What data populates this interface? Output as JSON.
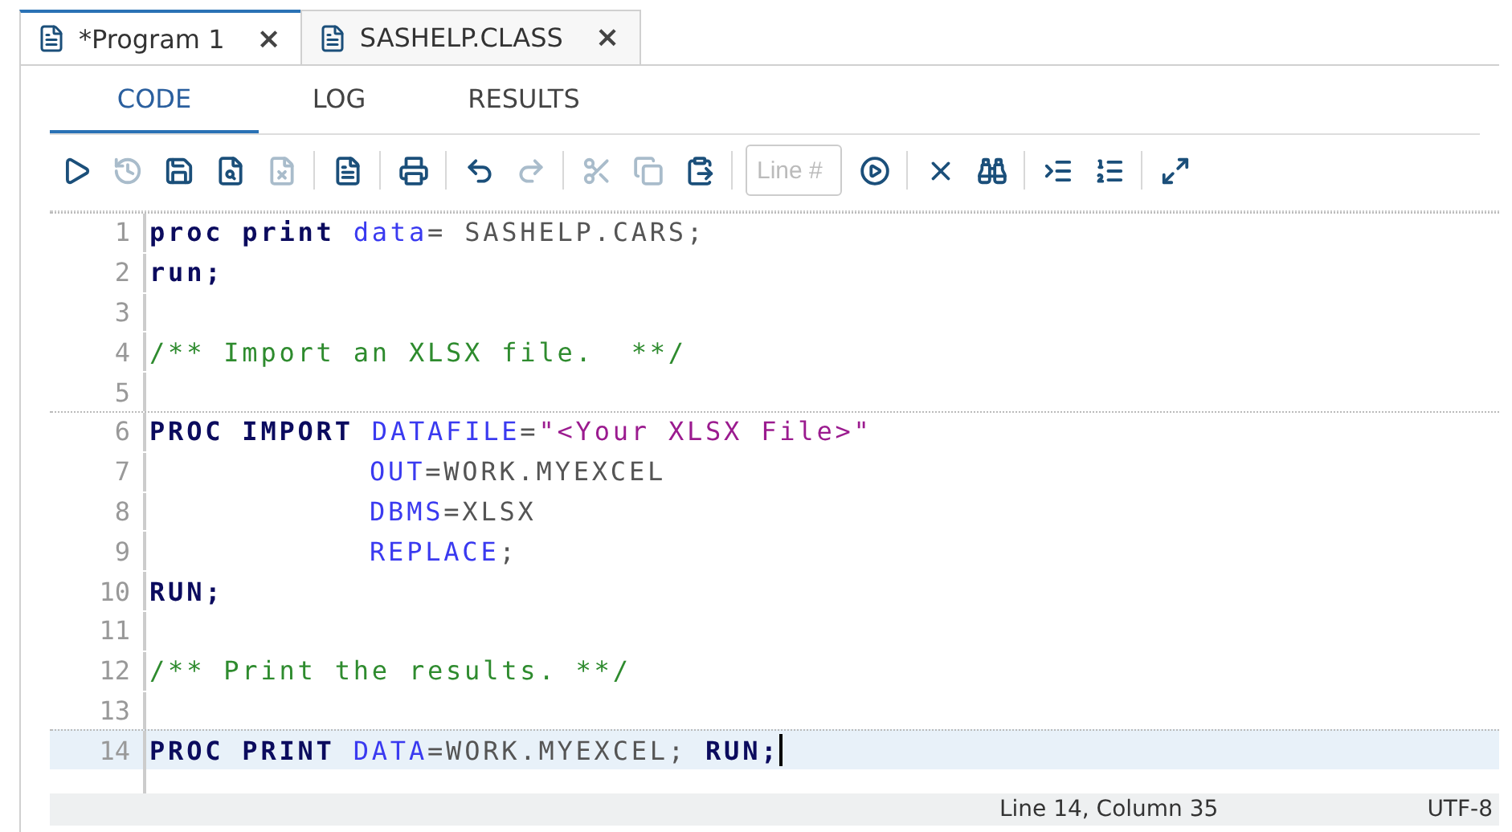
{
  "tabs": [
    {
      "label": "*Program 1",
      "selected": true,
      "close": "×"
    },
    {
      "label": "SASHELP.CLASS",
      "selected": false,
      "close": "×"
    }
  ],
  "subtabs": [
    {
      "label": "CODE",
      "selected": true
    },
    {
      "label": "LOG",
      "selected": false
    },
    {
      "label": "RESULTS",
      "selected": false
    }
  ],
  "toolbar": {
    "buttons": [
      {
        "disabled": false
      },
      {
        "disabled": true
      },
      {
        "disabled": false
      },
      {
        "disabled": false
      },
      {
        "disabled": true
      },
      {
        "disabled": false
      },
      {
        "disabled": false
      },
      {
        "disabled": false
      },
      {
        "disabled": true
      },
      {
        "disabled": true
      },
      {
        "disabled": true
      },
      {
        "disabled": false
      },
      {
        "disabled": false
      },
      {
        "disabled": false
      },
      {
        "disabled": false
      },
      {
        "disabled": false
      },
      {
        "disabled": false
      },
      {
        "disabled": false
      }
    ],
    "line_field": {
      "placeholder": "Line #"
    }
  },
  "editor": {
    "lines": [
      {
        "number": "1",
        "step_start": true,
        "current": false,
        "continuation": false,
        "tokens": [
          {
            "kind": "keyword",
            "text": "proc print"
          },
          {
            "kind": "option",
            "text": " data"
          },
          {
            "kind": "plain",
            "text": "= SASHELP.CARS;"
          }
        ]
      },
      {
        "number": "2",
        "step_start": false,
        "current": false,
        "continuation": false,
        "tokens": [
          {
            "kind": "keyword",
            "text": "run;"
          }
        ]
      },
      {
        "number": "3",
        "step_start": false,
        "current": false
      },
      {
        "number": "4",
        "step_start": false,
        "current": false,
        "continuation": false,
        "tokens": [
          {
            "kind": "comment",
            "text": "/** Import an XLSX file.  **/"
          }
        ]
      },
      {
        "number": "5",
        "step_start": false,
        "current": false
      },
      {
        "number": "6",
        "step_start": true,
        "current": false,
        "continuation": false,
        "tokens": [
          {
            "kind": "keyword",
            "text": "PROC IMPORT"
          },
          {
            "kind": "option",
            "text": " DATAFILE"
          },
          {
            "kind": "plain",
            "text": "="
          },
          {
            "kind": "string",
            "text": "\"<Your XLSX File>\""
          }
        ]
      },
      {
        "number": "7",
        "step_start": false,
        "current": false,
        "continuation": true,
        "tokens": [
          {
            "kind": "option",
            "text": "OUT"
          },
          {
            "kind": "plain",
            "text": "=WORK.MYEXCEL"
          }
        ]
      },
      {
        "number": "8",
        "step_start": false,
        "current": false,
        "continuation": true,
        "tokens": [
          {
            "kind": "option",
            "text": "DBMS"
          },
          {
            "kind": "plain",
            "text": "=XLSX"
          }
        ]
      },
      {
        "number": "9",
        "step_start": false,
        "current": false,
        "continuation": true,
        "tokens": [
          {
            "kind": "option",
            "text": "REPLACE"
          },
          {
            "kind": "plain",
            "text": ";"
          }
        ]
      },
      {
        "number": "10",
        "step_start": false,
        "current": false,
        "continuation": false,
        "tokens": [
          {
            "kind": "keyword",
            "text": "RUN;"
          }
        ]
      },
      {
        "number": "11",
        "step_start": false,
        "current": false
      },
      {
        "number": "12",
        "step_start": false,
        "current": false,
        "continuation": false,
        "tokens": [
          {
            "kind": "comment",
            "text": "/** Print the results. **/"
          }
        ]
      },
      {
        "number": "13",
        "step_start": false,
        "current": false
      },
      {
        "number": "14",
        "step_start": true,
        "current": true,
        "continuation": false,
        "tokens": [
          {
            "kind": "keyword",
            "text": "PROC PRINT"
          },
          {
            "kind": "option",
            "text": " DATA"
          },
          {
            "kind": "plain",
            "text": "=WORK.MYEXCEL; "
          },
          {
            "kind": "keyword",
            "text": "RUN;"
          }
        ]
      }
    ]
  },
  "status_bar": {
    "position": "Line 14, Column 35",
    "encoding": "UTF-8"
  }
}
